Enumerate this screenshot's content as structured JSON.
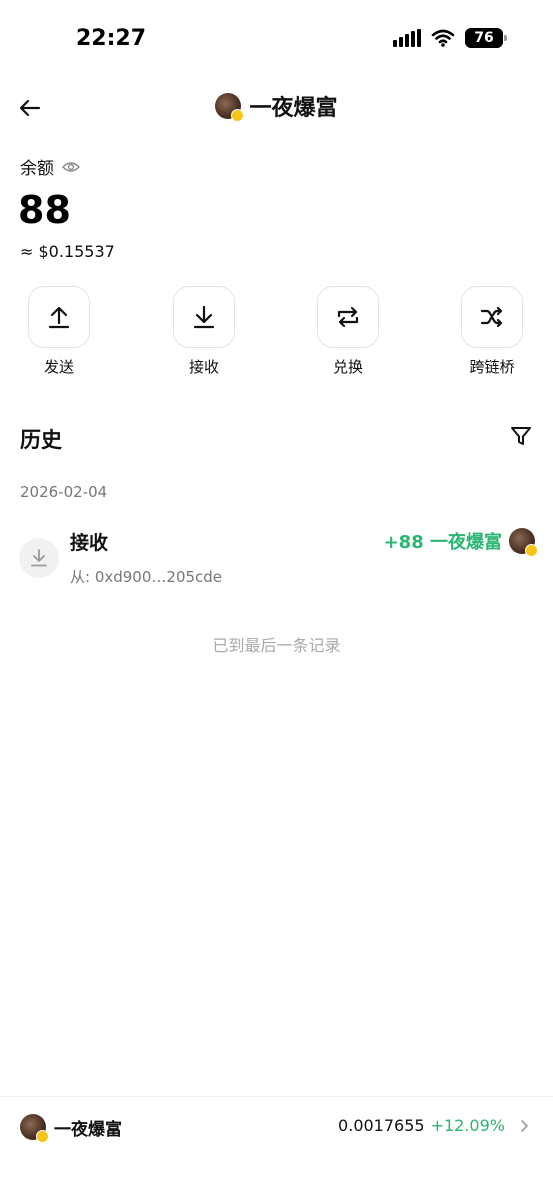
{
  "status_bar": {
    "time": "22:27",
    "battery": "76"
  },
  "header": {
    "title": "一夜爆富"
  },
  "balance": {
    "label": "余额",
    "amount": "88",
    "usd": "≈ $0.15537"
  },
  "actions": [
    {
      "label": "发送",
      "icon": "upload-icon"
    },
    {
      "label": "接收",
      "icon": "download-icon"
    },
    {
      "label": "兑换",
      "icon": "swap-icon"
    },
    {
      "label": "跨链桥",
      "icon": "shuffle-icon"
    }
  ],
  "history": {
    "title": "历史",
    "date": "2026-02-04",
    "items": [
      {
        "title": "接收",
        "from": "从: 0xd900…205cde",
        "amount": "+88 一夜爆富"
      }
    ],
    "end_note": "已到最后一条记录"
  },
  "bottom": {
    "name": "一夜爆富",
    "price": "0.0017655",
    "change": "+12.09%"
  },
  "colors": {
    "positive": "#2bb673",
    "muted": "#777777",
    "badge": "#f5c518"
  }
}
